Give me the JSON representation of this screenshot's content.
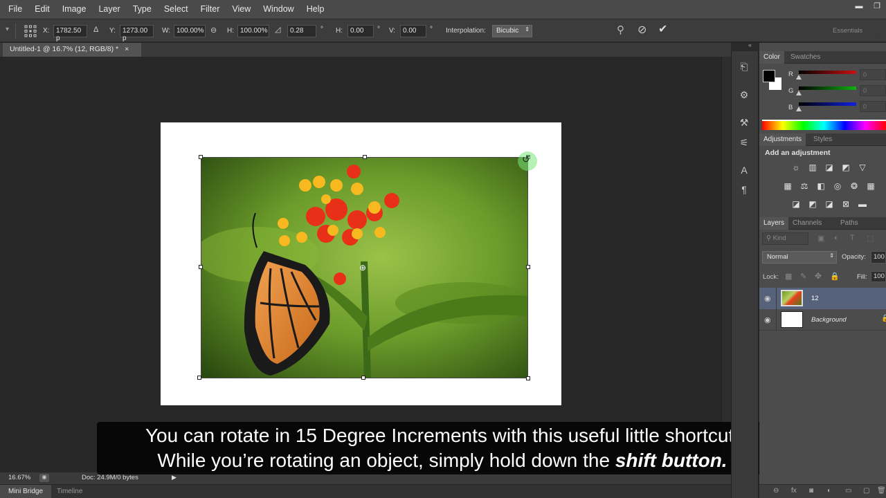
{
  "menu": [
    "File",
    "Edit",
    "Image",
    "Layer",
    "Type",
    "Select",
    "Filter",
    "View",
    "Window",
    "Help"
  ],
  "window_controls": [
    "minimize-icon",
    "restore-icon"
  ],
  "options": {
    "x_label": "X:",
    "x_value": "1782.50 p",
    "y_label": "Y:",
    "y_value": "1273.00 p",
    "w_label": "W:",
    "w_value": "100.00%",
    "h_label": "H:",
    "h_value": "100.00%",
    "angle_value": "0.28",
    "deg1": "°",
    "hskew_label": "H:",
    "hskew_value": "0.00",
    "deg2": "°",
    "vskew_label": "V:",
    "vskew_value": "0.00",
    "deg3": "°",
    "interp_label": "Interpolation:",
    "interp_value": "Bicubic",
    "workspace": "Essentials"
  },
  "document": {
    "tab_title": "Untitled-1 @ 16.7% (12, RGB/8) *",
    "close_glyph": "×",
    "zoom": "16.67%",
    "doc_info": "Doc: 24.9M/0 bytes"
  },
  "bottom_tabs": [
    "Mini Bridge",
    "Timeline"
  ],
  "subtitle": {
    "line1": "You can rotate in 15 Degree Increments with this useful little shortcut.",
    "line2_pre": "While you’re rotating an object, simply hold down the ",
    "line2_bold": "shift button."
  },
  "color_panel": {
    "tabs": [
      "Color",
      "Swatches"
    ],
    "channels": [
      "R",
      "G",
      "B"
    ],
    "values": [
      "0",
      "0",
      "0"
    ],
    "channel_colors": [
      "#cc1010",
      "#10b010",
      "#1020e0"
    ]
  },
  "adjustments_panel": {
    "tabs": [
      "Adjustments",
      "Styles"
    ],
    "heading": "Add an adjustment"
  },
  "layers_panel": {
    "tabs": [
      "Layers",
      "Channels",
      "Paths"
    ],
    "kind_filter": "Kind",
    "blend_mode": "Normal",
    "opacity_label": "Opacity:",
    "opacity_value": "100",
    "lock_label": "Lock:",
    "fill_label": "Fill:",
    "fill_value": "100",
    "layers": [
      {
        "name": "12",
        "selected": true
      },
      {
        "name": "Background",
        "selected": false
      }
    ]
  }
}
